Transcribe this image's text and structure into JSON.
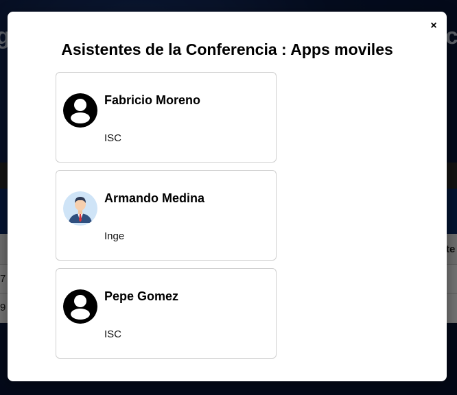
{
  "background": {
    "title_fragment_left": "g",
    "title_fragment_right": "ac",
    "table_fragment_header": "te",
    "row1_fragment": "7",
    "row2_fragment": "9"
  },
  "modal": {
    "title": "Asistentes de la Conferencia : Apps moviles",
    "close_label": "×",
    "attendees": [
      {
        "name": "Fabricio Moreno",
        "role": "ISC",
        "avatar": "default-user-icon"
      },
      {
        "name": "Armando Medina",
        "role": "Inge",
        "avatar": "businessman-photo"
      },
      {
        "name": "Pepe Gomez",
        "role": "ISC",
        "avatar": "default-user-icon"
      }
    ]
  }
}
